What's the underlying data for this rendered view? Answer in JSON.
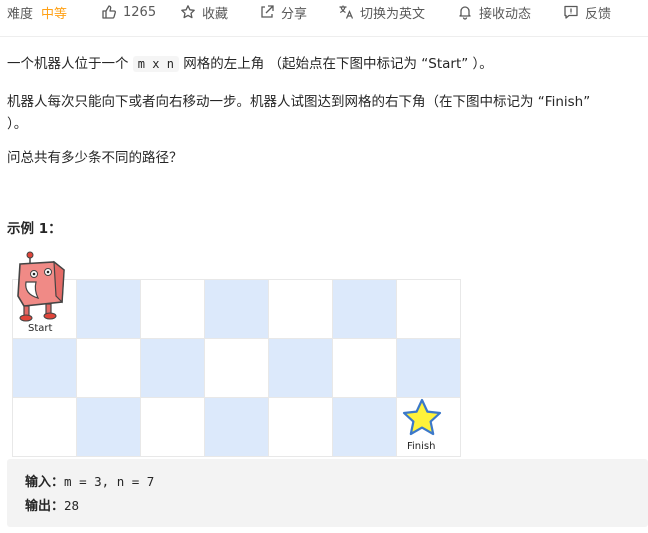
{
  "toolbar": {
    "difficulty_label": "难度",
    "difficulty_value": "中等",
    "likes": "1265",
    "favorite": "收藏",
    "share": "分享",
    "switch_lang": "切换为英文",
    "notify": "接收动态",
    "feedback": "反馈",
    "accent_color": "#ffa116"
  },
  "problem": {
    "p1_a": "一个机器人位于一个 ",
    "p1_code": "m x n",
    "p1_b": " 网格的左上角 （起始点在下图中标记为 “Start” ）。",
    "p2_a": "机器人每次只能向下或者向右移动一步。机器人试图达到网格的右下角（在下图中标记为 “Finish”",
    "p2_b": "）。",
    "p3": "问总共有多少条不同的路径？"
  },
  "example": {
    "title": "示例 1：",
    "start_label": "Start",
    "finish_label": "Finish",
    "input_label": "输入：",
    "input_value": "m = 3, n = 7",
    "output_label": "输出：",
    "output_value": "28"
  },
  "colors": {
    "cell_blue": "#dce9fb",
    "cell_white": "#ffffff"
  }
}
